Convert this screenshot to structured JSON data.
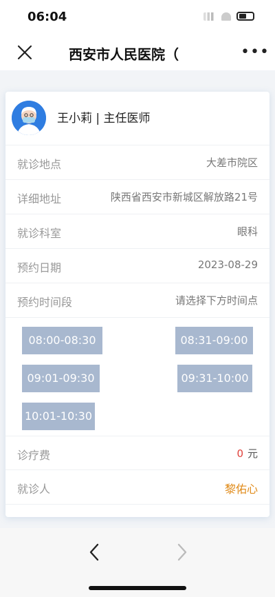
{
  "status": {
    "time": "06:04"
  },
  "nav": {
    "title": "西安市人民医院（",
    "more": "•••"
  },
  "doctor": {
    "name_title": "王小莉 | 主任医师"
  },
  "rows": [
    {
      "label": "就诊地点",
      "value": "大差市院区"
    },
    {
      "label": "详细地址",
      "value": "陕西省西安市新城区解放路21号"
    },
    {
      "label": "就诊科室",
      "value": "眼科"
    },
    {
      "label": "预约日期",
      "value": "2023-08-29"
    },
    {
      "label": "预约时间段",
      "value": "请选择下方时间点"
    }
  ],
  "slots": [
    "08:00-08:30",
    "08:31-09:00",
    "09:01-09:30",
    "09:31-10:00",
    "10:01-10:30"
  ],
  "fee": {
    "label": "诊疗费",
    "amount": "0",
    "unit": "元"
  },
  "patient": {
    "label": "就诊人",
    "value": "黎佑心"
  },
  "colors": {
    "slot": "#a8b8cf",
    "fee_amount": "#e0403a",
    "patient": "#e08a18",
    "avatar": "#2f7de1"
  }
}
